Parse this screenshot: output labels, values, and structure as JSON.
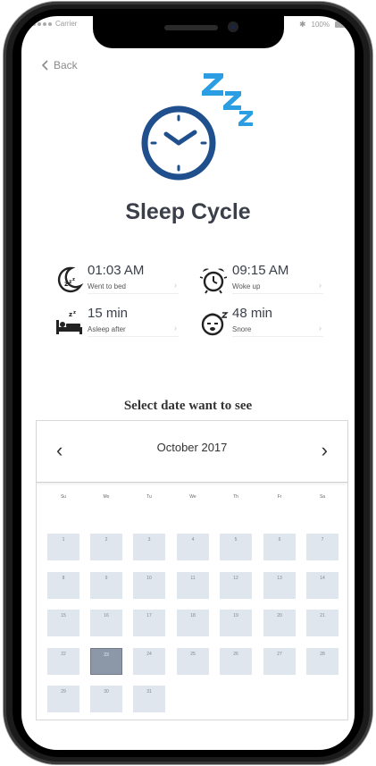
{
  "status": {
    "carrier": "Carrier",
    "battery": "100%"
  },
  "nav": {
    "back_label": "Back"
  },
  "app": {
    "title": "Sleep Cycle"
  },
  "stats": [
    {
      "value": "01:03  AM",
      "label": "Went to bed",
      "icon": "moon-sleep-icon"
    },
    {
      "value": "09:15  AM",
      "label": "Woke up",
      "icon": "alarm-clock-icon"
    },
    {
      "value": "15 min",
      "label": "Asleep after",
      "icon": "bed-icon"
    },
    {
      "value": "48 min",
      "label": "Snore",
      "icon": "snore-icon"
    }
  ],
  "calendar": {
    "heading": "Select date want to see",
    "month": "October 2017",
    "weekdays": [
      "Su",
      "Mo",
      "Tu",
      "We",
      "Th",
      "Fr",
      "Sa"
    ],
    "days": [
      "1",
      "2",
      "3",
      "4",
      "5",
      "6",
      "7",
      "8",
      "9",
      "10",
      "11",
      "12",
      "13",
      "14",
      "15",
      "16",
      "17",
      "18",
      "19",
      "20",
      "21",
      "22",
      "23",
      "24",
      "25",
      "26",
      "27",
      "28",
      "29",
      "30",
      "31"
    ],
    "selected_day": "23"
  },
  "colors": {
    "accent": "#2a9de3",
    "clock_navy": "#1f4f8c",
    "day_cell": "#e0e6ee",
    "day_selected": "#8c98a8",
    "title_text": "#3a3f4a"
  }
}
